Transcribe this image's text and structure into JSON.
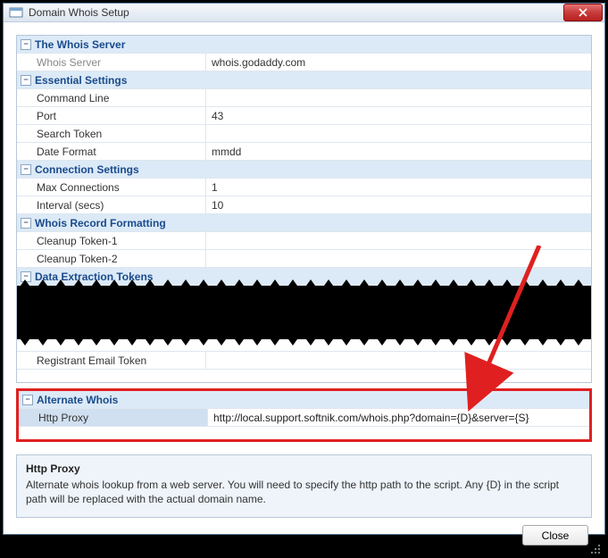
{
  "window": {
    "title": "Domain Whois Setup"
  },
  "sections": {
    "whois_server": {
      "title": "The Whois Server",
      "whois_server_label": "Whois Server",
      "whois_server_value": "whois.godaddy.com"
    },
    "essential": {
      "title": "Essential Settings",
      "command_line_label": "Command Line",
      "command_line_value": "",
      "port_label": "Port",
      "port_value": "43",
      "search_token_label": "Search Token",
      "search_token_value": "",
      "date_format_label": "Date Format",
      "date_format_value": "mmdd"
    },
    "connection": {
      "title": "Connection Settings",
      "max_conn_label": "Max Connections",
      "max_conn_value": "1",
      "interval_label": "Interval (secs)",
      "interval_value": "10"
    },
    "formatting": {
      "title": "Whois Record Formatting",
      "cleanup1_label": "Cleanup Token-1",
      "cleanup1_value": "",
      "cleanup2_label": "Cleanup Token-2",
      "cleanup2_value": ""
    },
    "extraction": {
      "title": "Data Extraction Tokens",
      "registrant_email_label": "Registrant Email Token",
      "registrant_email_value": ""
    },
    "alternate": {
      "title": "Alternate Whois",
      "http_proxy_label": "Http Proxy",
      "http_proxy_value": "http://local.support.softnik.com/whois.php?domain={D}&server={S}"
    }
  },
  "help": {
    "title": "Http Proxy",
    "text": "Alternate whois lookup from a web server. You will need to specify the http path to the script. Any {D} in the script path will be replaced with the actual domain name."
  },
  "buttons": {
    "close": "Close"
  },
  "icons": {
    "expander_minus": "⊟"
  }
}
